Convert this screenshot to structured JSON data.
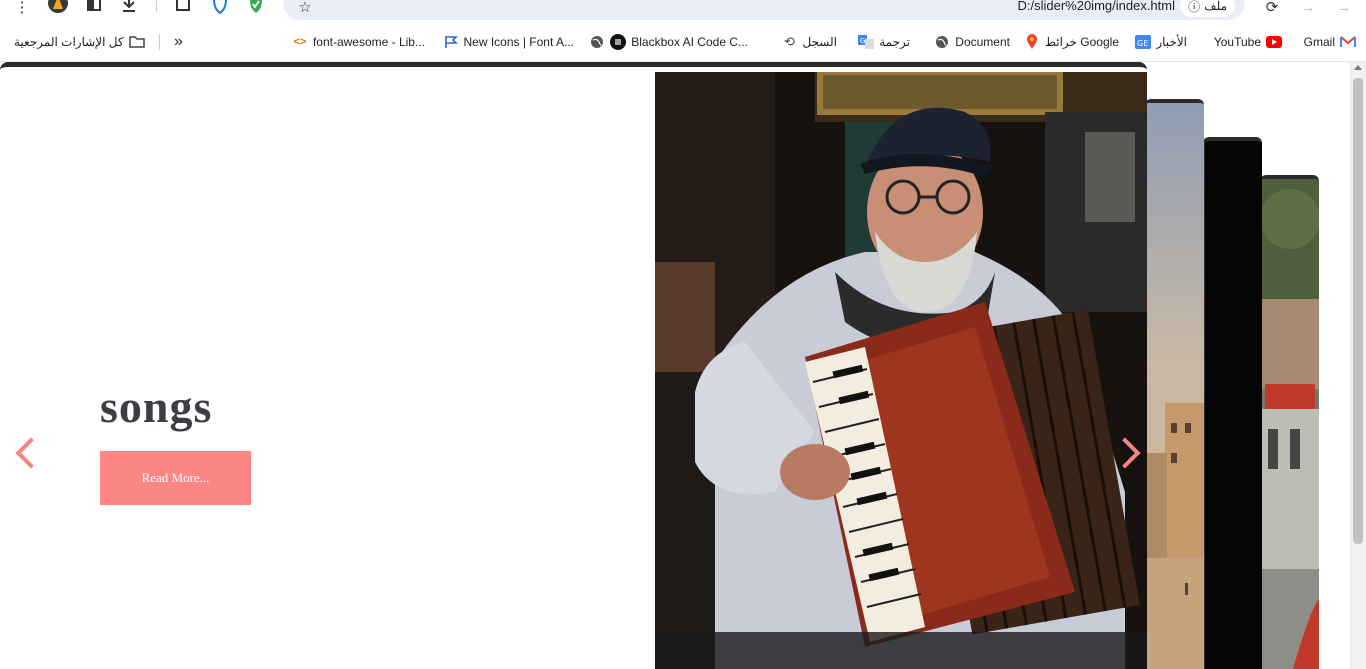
{
  "browser": {
    "url": "D:/slider%20img/index.html",
    "file_chip": "ملف",
    "bookmarks": [
      {
        "label": "Gmail",
        "icon": "gmail-icon"
      },
      {
        "label": "YouTube",
        "icon": "youtube-icon"
      },
      {
        "label": "الأخبار",
        "icon": "news-icon"
      },
      {
        "label": "خرائط Google",
        "icon": "maps-icon"
      },
      {
        "label": "Document",
        "icon": "globe-icon"
      },
      {
        "label": "ترجمة",
        "icon": "translate-icon"
      },
      {
        "label": "السجل",
        "icon": "history-icon"
      },
      {
        "label": "Blackbox AI Code C...",
        "icon": "blackbox-icon"
      },
      {
        "label": "New Icons | Font A...",
        "icon": "flag-icon"
      },
      {
        "label": "font-awesome - Lib...",
        "icon": "code-icon"
      }
    ],
    "all_bookmarks": "كل الإشارات المرجعية",
    "more": "»"
  },
  "slider": {
    "title": "songs",
    "button_label": "Read More...",
    "accent": "#fc8686",
    "title_color": "#3d3d45"
  }
}
